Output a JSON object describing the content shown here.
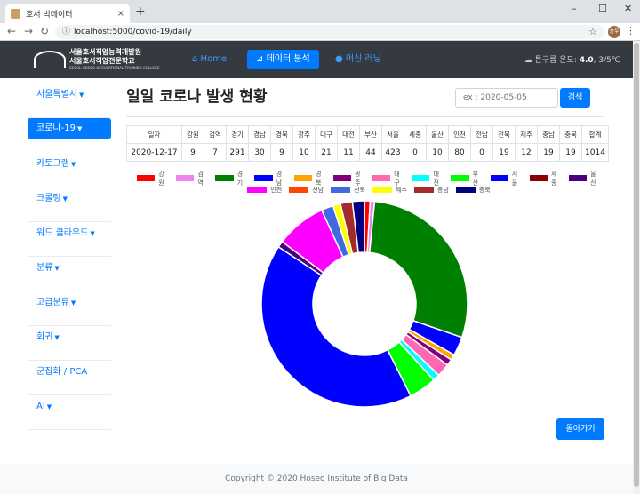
{
  "browser": {
    "tab_title": "호서 빅데이터",
    "tab_close": "×",
    "new_tab": "+",
    "url": "localhost:5000/covid-19/daily",
    "controls": [
      "–",
      "☐",
      "✕"
    ],
    "profile_label": "승우"
  },
  "header": {
    "logo_line1": "서울호서직업능력개발원",
    "logo_line2": "서울호서직업전문학교",
    "logo_line3": "SEOUL HOSEO OCCUPATIONAL TRAINING COLLEGE",
    "nav": [
      {
        "label": "Home",
        "icon": "home-icon"
      },
      {
        "label": "데이터 분석",
        "icon": "chart-icon"
      },
      {
        "label": "머신 러닝",
        "icon": "brain-icon"
      }
    ],
    "weather_prefix": "튼구름 온도: ",
    "weather_temp": "4.0",
    "weather_suffix": ", 3/5℃"
  },
  "sidebar": {
    "items": [
      {
        "label": "서울특별시",
        "caret": true
      },
      {
        "label": "코로나-19",
        "caret": true,
        "active": true
      },
      {
        "label": "카토그램",
        "caret": true
      },
      {
        "label": "크롤링",
        "caret": true
      },
      {
        "label": "워드 클라우드",
        "caret": true
      },
      {
        "label": "분류",
        "caret": true
      },
      {
        "label": "고급분류",
        "caret": true
      },
      {
        "label": "회귀",
        "caret": true
      },
      {
        "label": "군집화 / PCA",
        "caret": false
      },
      {
        "label": "AI",
        "caret": true
      }
    ]
  },
  "main": {
    "title": "일일 코로나 발생 현황",
    "date_placeholder": "ex : 2020-05-05",
    "search_label": "검색",
    "back_label": "돌아가기"
  },
  "table": {
    "headers": [
      "일자",
      "강원",
      "검역",
      "경기",
      "경남",
      "경북",
      "광주",
      "대구",
      "대전",
      "부산",
      "서울",
      "세종",
      "울산",
      "인천",
      "전남",
      "전북",
      "제주",
      "충남",
      "충북",
      "합계"
    ],
    "row": [
      "2020-12-17",
      "9",
      "7",
      "291",
      "30",
      "9",
      "10",
      "21",
      "11",
      "44",
      "423",
      "0",
      "10",
      "80",
      "0",
      "19",
      "12",
      "19",
      "19",
      "1014"
    ]
  },
  "chart_data": {
    "type": "pie",
    "donut": true,
    "categories": [
      "강원",
      "검역",
      "경기",
      "경남",
      "경북",
      "광주",
      "대구",
      "대전",
      "부산",
      "서울",
      "세종",
      "울산",
      "인천",
      "전남",
      "전북",
      "제주",
      "충남",
      "충북"
    ],
    "values": [
      9,
      7,
      291,
      30,
      9,
      10,
      21,
      11,
      44,
      423,
      0,
      10,
      80,
      0,
      19,
      12,
      19,
      19
    ],
    "colors": [
      "#ff0000",
      "#ee82ee",
      "#008000",
      "#0000ff",
      "#ffa500",
      "#800080",
      "#ff69b4",
      "#00ffff",
      "#00ff00",
      "#0000ff",
      "#8b0000",
      "#4b0082",
      "#ff00ff",
      "#ff4500",
      "#4169e1",
      "#ffff00",
      "#a52a2a",
      "#000080"
    ],
    "legend_position": "top"
  },
  "footer": {
    "text": "Copyright © 2020 Hoseo Institute of Big Data"
  }
}
